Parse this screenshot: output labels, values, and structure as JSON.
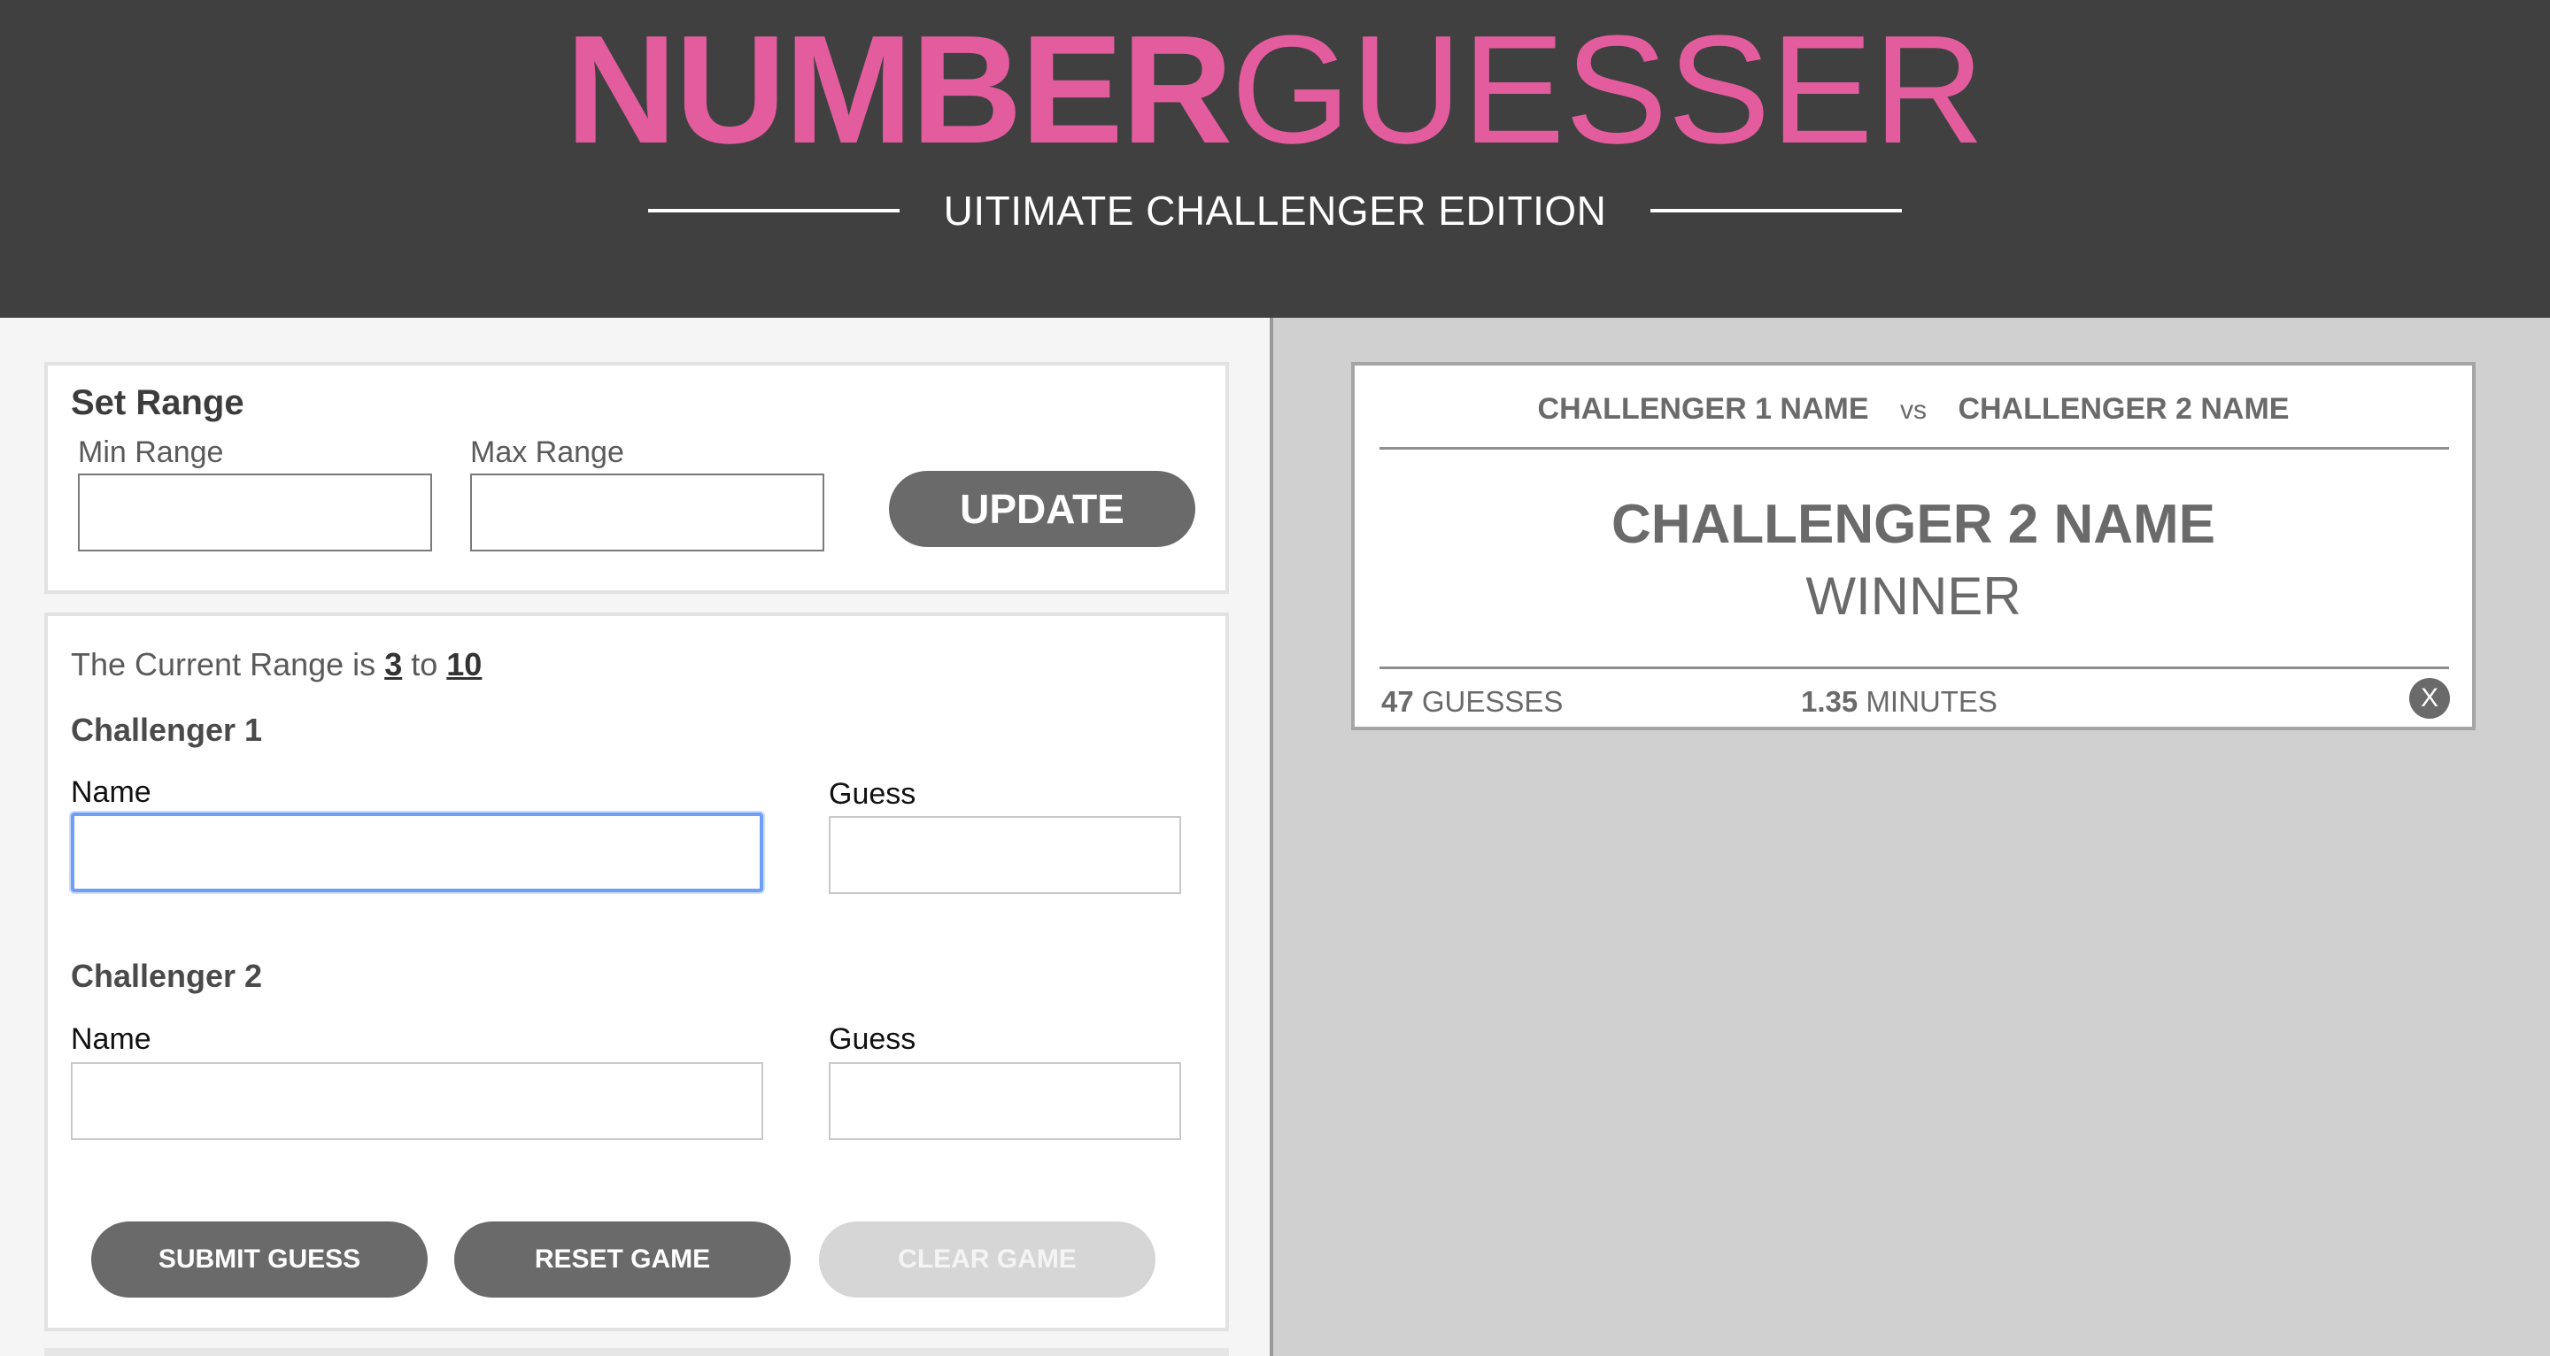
{
  "header": {
    "title_bold": "NUMBER",
    "title_light": "GUESSER",
    "subtitle": "UITIMATE CHALLENGER EDITION",
    "colors": {
      "background": "#404040",
      "accent": "#e35d9e"
    }
  },
  "range_form": {
    "title": "Set Range",
    "min_label": "Min Range",
    "min_value": "",
    "max_label": "Max Range",
    "max_value": "",
    "update_label": "UPDATE"
  },
  "game_form": {
    "range_prefix": "The Current Range is",
    "range_min": "3",
    "range_joiner": "to",
    "range_max": "10",
    "challenger1": {
      "title": "Challenger 1",
      "name_label": "Name",
      "name_value": "",
      "guess_label": "Guess",
      "guess_value": ""
    },
    "challenger2": {
      "title": "Challenger 2",
      "name_label": "Name",
      "name_value": "",
      "guess_label": "Guess",
      "guess_value": ""
    },
    "buttons": {
      "submit": "SUBMIT GUESS",
      "reset": "RESET GAME",
      "clear": "CLEAR GAME"
    }
  },
  "result": {
    "challenger1_name": "CHALLENGER 1 NAME",
    "vs": "vs",
    "challenger2_name": "CHALLENGER 2 NAME",
    "winner_name": "CHALLENGER 2 NAME",
    "winner_label": "WINNER",
    "guesses_count": "47",
    "guesses_label": "GUESSES",
    "minutes_value": "1.35",
    "minutes_label": "MINUTES",
    "close_label": "X"
  }
}
